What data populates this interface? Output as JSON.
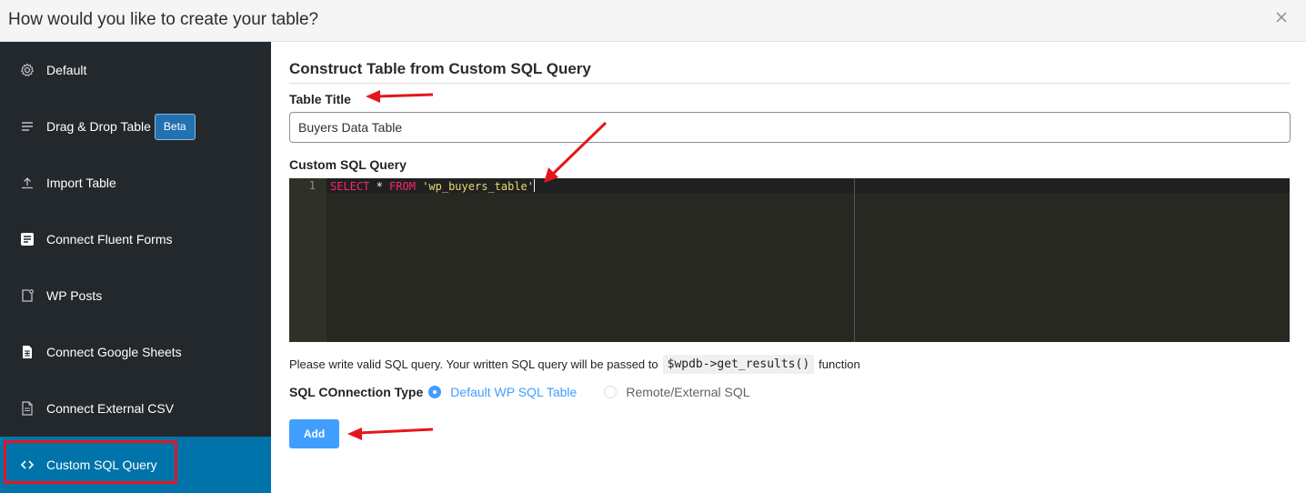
{
  "modal": {
    "title": "How would you like to create your table?",
    "close_icon": "close-icon"
  },
  "sidebar": {
    "items": [
      {
        "label": "Default",
        "icon": "gear-icon"
      },
      {
        "label": "Drag & Drop Table",
        "icon": "hamburger-list-icon",
        "badge": "Beta"
      },
      {
        "label": "Import Table",
        "icon": "upload-icon"
      },
      {
        "label": "Connect Fluent Forms",
        "icon": "form-icon"
      },
      {
        "label": "WP Posts",
        "icon": "post-icon"
      },
      {
        "label": "Connect Google Sheets",
        "icon": "spreadsheet-icon"
      },
      {
        "label": "Connect External CSV",
        "icon": "document-icon"
      },
      {
        "label": "Custom SQL Query",
        "icon": "code-brackets-icon",
        "active": true
      }
    ]
  },
  "main": {
    "section_title": "Construct Table from Custom SQL Query",
    "table_title_label": "Table Title",
    "table_title_value": "Buyers Data Table",
    "sql_label": "Custom SQL Query",
    "editor": {
      "line_number": "1",
      "kw_select": "SELECT",
      "star": " * ",
      "kw_from": "FROM",
      "space": " ",
      "table_string": "'wp_buyers_table'"
    },
    "help_text_before": "Please write valid SQL query. Your written SQL query will be passed to",
    "help_code": "$wpdb->get_results()",
    "help_text_after": "function",
    "connection_label": "SQL COnnection Type",
    "connection_options": [
      {
        "label": "Default WP SQL Table",
        "selected": true
      },
      {
        "label": "Remote/External SQL",
        "selected": false
      }
    ],
    "add_button": "Add"
  },
  "colors": {
    "sidebar_bg": "#23282d",
    "sidebar_active": "#0073aa",
    "primary": "#409eff",
    "annotation_red": "#e4161d",
    "editor_bg": "#272822"
  }
}
